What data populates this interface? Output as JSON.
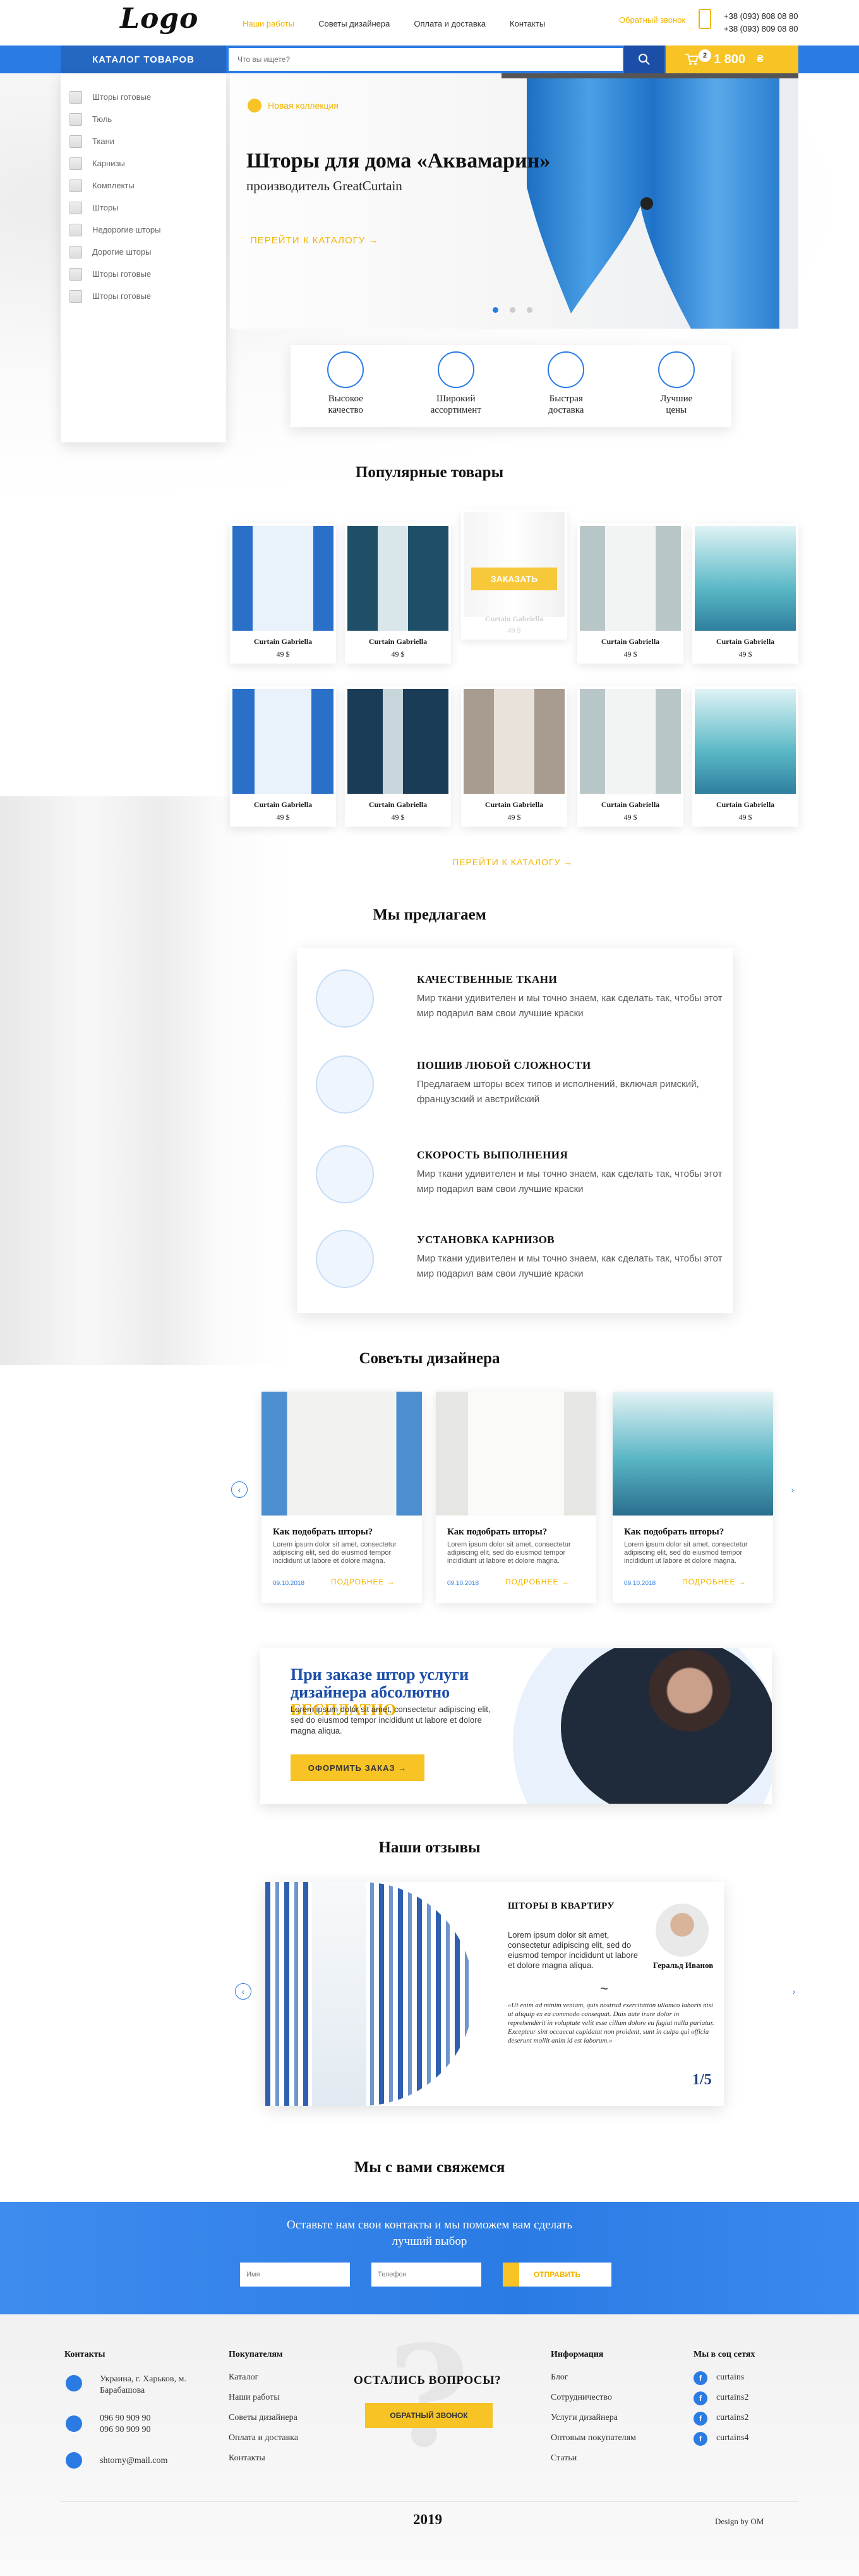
{
  "header": {
    "logo": "Logo",
    "nav": [
      "Наши работы",
      "Советы дизайнера",
      "Оплата и доставка",
      "Контакты"
    ],
    "callback": "Обратный звонок",
    "phones": [
      "+38 (093) 808 08 80",
      "+38 (093) 809 08 80"
    ]
  },
  "bar": {
    "catalog": "КАТАЛОГ ТОВАРОВ",
    "search_placeholder": "Что вы ищете?",
    "cart_count": "2",
    "cart_total": "1 800",
    "cart_currency": "₴"
  },
  "sidebar": [
    "Шторы готовые",
    "Тюль",
    "Ткани",
    "Карнизы",
    "Комплекты",
    "Шторы",
    "Недорогие шторы",
    "Дорогие шторы",
    "Шторы готовые",
    "Шторы готовые"
  ],
  "hero": {
    "tag": "Новая коллекция",
    "title": "Шторы для дома «Аквамарин»",
    "subtitle": "производитель GreatCurtain",
    "link": "ПЕРЕЙТИ К КАТАЛОГУ"
  },
  "features": [
    {
      "line1": "Высокое",
      "line2": "качество"
    },
    {
      "line1": "Широкий",
      "line2": "ассортимент"
    },
    {
      "line1": "Быстрая",
      "line2": "доставка"
    },
    {
      "line1": "Лучшие",
      "line2": "цены"
    }
  ],
  "popular": {
    "title": "Популярные товары",
    "order_label": "ЗАКАЗАТЬ",
    "row1": [
      {
        "name": "Curtain Gabriella",
        "price": "49 $"
      },
      {
        "name": "Curtain Gabriella",
        "price": "49 $"
      },
      {
        "name": "Curtain Gabriella",
        "price": "49 $"
      },
      {
        "name": "Curtain Gabriella",
        "price": "49 $"
      },
      {
        "name": "Curtain Gabriella",
        "price": "49 $"
      }
    ],
    "row2": [
      {
        "name": "Curtain Gabriella",
        "price": "49 $"
      },
      {
        "name": "Curtain Gabriella",
        "price": "49 $"
      },
      {
        "name": "Curtain Gabriella",
        "price": "49 $"
      },
      {
        "name": "Curtain Gabriella",
        "price": "49 $"
      },
      {
        "name": "Curtain Gabriella",
        "price": "49 $"
      }
    ],
    "catalog_link": "ПЕРЕЙТИ К КАТАЛОГУ"
  },
  "offer": {
    "title": "Мы предлагаем",
    "items": [
      {
        "title": "КАЧЕСТВЕННЫЕ ТКАНИ",
        "text": "Мир ткани удивителен и мы точно знаем, как сделать так, чтобы этот мир подарил вам свои лучшие краски"
      },
      {
        "title": "ПОШИВ ЛЮБОЙ СЛОЖНОСТИ",
        "text": "Предлагаем шторы всех типов и исполнений, включая римский, французский и австрийский"
      },
      {
        "title": "СКОРОСТЬ ВЫПОЛНЕНИЯ",
        "text": "Мир ткани удивителен и мы точно знаем, как сделать так, чтобы этот мир подарил вам свои лучшие краски"
      },
      {
        "title": "УСТАНОВКА КАРНИЗОВ",
        "text": "Мир ткани удивителен и мы точно знаем, как сделать так, чтобы этот мир подарил вам свои лучшие краски"
      }
    ]
  },
  "tips": {
    "title": "Совеъты дизайнера",
    "items": [
      {
        "title": "Как подобрать шторы?",
        "text": "Lorem ipsum dolor sit amet, consectetur adipiscing elit, sed do eiusmod tempor incididunt ut labore et dolore magna.",
        "date": "09.10.2018",
        "more": "ПОДРОБНЕЕ"
      },
      {
        "title": "Как подобрать шторы?",
        "text": "Lorem ipsum dolor sit amet, consectetur adipiscing elit, sed do eiusmod tempor incididunt ut labore et dolore magna.",
        "date": "09.10.2018",
        "more": "ПОДРОБНЕЕ"
      },
      {
        "title": "Как подобрать шторы?",
        "text": "Lorem ipsum dolor sit amet, consectetur adipiscing elit, sed do eiusmod tempor incididunt ut labore et dolore magna.",
        "date": "09.10.2018",
        "more": "ПОДРОБНЕЕ"
      }
    ]
  },
  "promo": {
    "title": "При заказе штор услуги дизайнера абсолютно",
    "free": "БЕСПЛАТНО",
    "text": "Lorem ipsum dolor sit amet, consectetur adipiscing elit, sed do eiusmod tempor incididunt ut labore et dolore magna aliqua.",
    "button": "ОФОРМИТЬ ЗАКАЗ"
  },
  "reviews": {
    "title": "Наши отзывы",
    "card_title": "ШТОРЫ В КВАРТИРУ",
    "text": "Lorem ipsum dolor sit amet, consectetur adipiscing elit, sed do eiusmod tempor incididunt ut labore et dolore magna aliqua.",
    "author": "Геральд Иванов",
    "quote": "«Ut enim ad minim veniam, quis nostrud exercitation ullamco laboris nisi ut aliquip ex ea commodo consequat. Duis aute irure dolor in reprehenderit in voluptate velit esse cillum dolore eu fugiat nulla pariatur. Excepteur sint occaecat cupidatat non proident, sunt in culpa qui officia deserunt mollit anim id est laborum.»",
    "pages": "1/5"
  },
  "contact": {
    "title": "Мы с вами свяжемся",
    "text_line1": "Оставьте нам свои контакты и мы поможем вам сделать",
    "text_line2": "лучший выбор",
    "name_placeholder": "Имя",
    "phone_placeholder": "Телефон",
    "send": "ОТПРАВИТЬ"
  },
  "footer": {
    "contacts_title": "Контакты",
    "address_line1": "Украина, г. Харьков, м.",
    "address_line2": "Барабашова",
    "phone1": "096 90 909 90",
    "phone2": "096 90 909 90",
    "email": "shtorny@mail.com",
    "buyers_title": "Покупателям",
    "buyers": [
      "Каталог",
      "Наши работы",
      "Советы дизайнера",
      "Оплата и доставка",
      "Контакты"
    ],
    "question": "ОСТАЛИСЬ ВОПРОСЫ?",
    "question_button": "ОБРАТНЫЙ ЗВОНОК",
    "info_title": "Информация",
    "info": [
      "Блог",
      "Сотрудничество",
      "Услуги дизайнера",
      "Оптовым покупателям",
      "Статьи"
    ],
    "social_title": "Мы в соц сетях",
    "social": [
      "curtains",
      "curtains2",
      "curtains2",
      "curtains4"
    ],
    "year": "2019",
    "design": "Design by OM"
  },
  "colors": {
    "blue": "#2a7be4",
    "yellow": "#f7c325",
    "dark_blue": "#1c4ea8"
  }
}
